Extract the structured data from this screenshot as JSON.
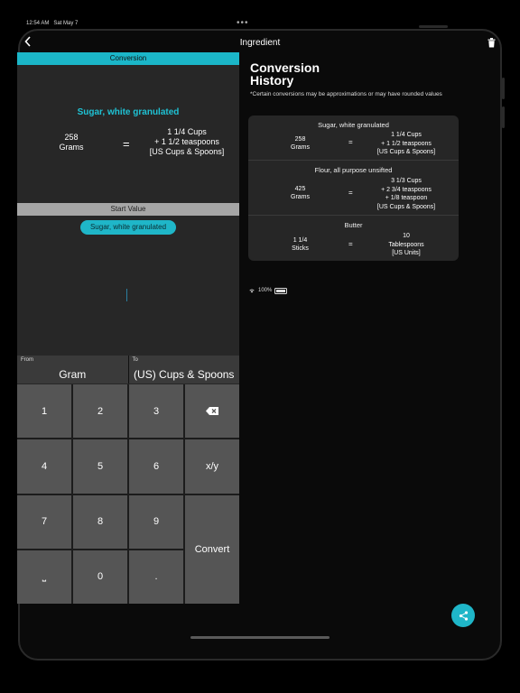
{
  "status": {
    "time": "12:54 AM",
    "date": "Sat May 7",
    "battery": "100%"
  },
  "nav": {
    "title": "Ingredient",
    "back_icon": "chevron-left-icon",
    "trash_icon": "trash-icon"
  },
  "conversion": {
    "header": "Conversion",
    "ingredient": "Sugar, white granulated",
    "left_value": "258",
    "left_unit": "Grams",
    "equals": "=",
    "right_line1": "1 1/4 Cups",
    "right_line2": "+ 1 1/2 teaspoons",
    "right_line3": "[US Cups & Spoons]"
  },
  "start": {
    "header": "Start Value",
    "chip": "Sugar, white granulated"
  },
  "units": {
    "from_label": "From",
    "from_value": "Gram",
    "to_label": "To",
    "to_value": "(US) Cups & Spoons"
  },
  "keypad": {
    "k1": "1",
    "k2": "2",
    "k3": "3",
    "k4": "4",
    "k5": "5",
    "k6": "6",
    "xy": "x/y",
    "k7": "7",
    "k8": "8",
    "k9": "9",
    "space": "⎵",
    "k0": "0",
    "dot": ".",
    "convert": "Convert"
  },
  "history": {
    "title_line1": "Conversion",
    "title_line2": "History",
    "note": "*Certain conversions may be approximations or may have rounded values",
    "items": [
      {
        "title": "Sugar, white granulated",
        "left1": "258",
        "left2": "Grams",
        "eq": "=",
        "r1": "1 1/4 Cups",
        "r2": "+ 1 1/2 teaspoons",
        "r3": "[US Cups & Spoons]",
        "r4": ""
      },
      {
        "title": "Flour, all purpose unsifted",
        "left1": "425",
        "left2": "Grams",
        "eq": "=",
        "r1": "3 1/3 Cups",
        "r2": "+ 2 3/4 teaspoons",
        "r3": "+ 1/8 teaspoon",
        "r4": "[US Cups & Spoons]"
      },
      {
        "title": "Butter",
        "left1": "1 1/4",
        "left2": "Sticks",
        "eq": "=",
        "r1": "10",
        "r2": "Tablespoons",
        "r3": "[US Units]",
        "r4": ""
      }
    ]
  },
  "colors": {
    "accent": "#1fb6c8",
    "panel": "#272727",
    "key": "#555555"
  }
}
